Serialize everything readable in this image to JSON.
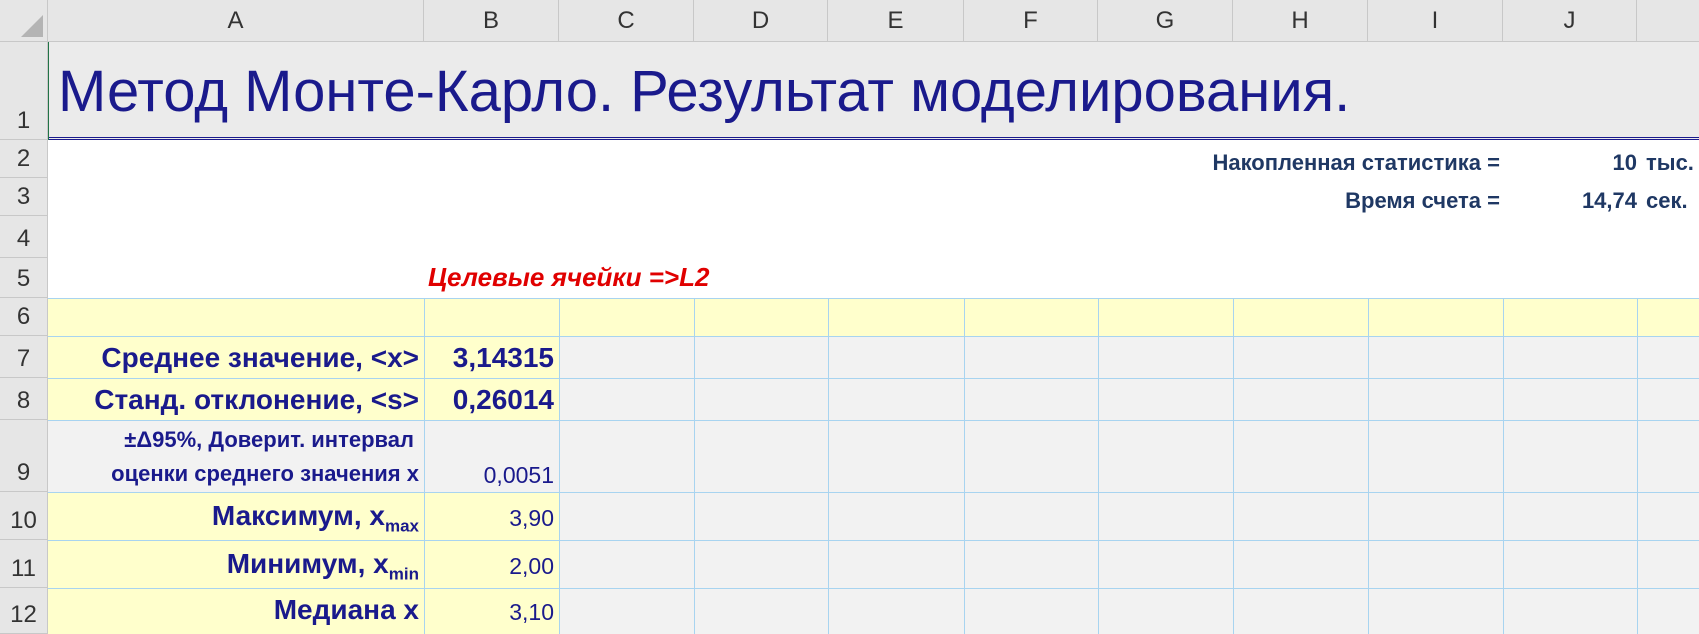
{
  "columns": [
    "A",
    "B",
    "C",
    "D",
    "E",
    "F",
    "G",
    "H",
    "I",
    "J"
  ],
  "rows": [
    "1",
    "2",
    "3",
    "4",
    "5",
    "6",
    "7",
    "8",
    "9",
    "10",
    "11",
    "12"
  ],
  "title": "Метод Монте-Карло. Результат моделирования.",
  "stats": {
    "accumulated_label": "Накопленная статистика =",
    "accumulated_value": "10",
    "accumulated_unit": "тыс.",
    "time_label": "Время счета =",
    "time_value": "14,74",
    "time_unit": "сек."
  },
  "target_cells": "Целевые ячейки =>L2",
  "results": {
    "mean_label": "Среднее значение, <x>",
    "mean_value": "3,14315",
    "std_label": "Станд. отклонение, <s>",
    "std_value": "0,26014",
    "ci_label_line1": "±Δ95%, Доверит. интервал",
    "ci_label_line2": "оценки среднего значения x",
    "ci_value": "0,0051",
    "max_label": "Максимум,   x",
    "max_sub": "max",
    "max_value": "3,90",
    "min_label": "Минимум, x",
    "min_sub": "min",
    "min_value": "2,00",
    "median_label": "Медиана x",
    "median_value": "3,10"
  },
  "colors": {
    "title": "#1a1a8c",
    "target": "#e00000",
    "stats": "#1f3864",
    "highlight_fill": "#ffffcc",
    "grid": "#a8d4f0"
  }
}
